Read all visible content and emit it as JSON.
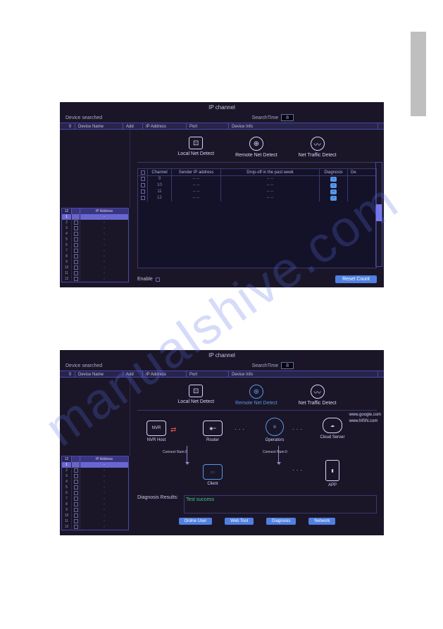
{
  "watermark": "manualshive.com",
  "screenshot1": {
    "title": "IP channel",
    "device_searched": "Device searched",
    "search_time_label": "SearchTime",
    "search_time_value": "8",
    "header": {
      "count": "0",
      "device_name": "Device Name",
      "add": "Add",
      "ip_address": "IP Address",
      "port": "Port",
      "device_info": "Device Info"
    },
    "tabs": {
      "local": "Local Net Detect",
      "remote": "Remote Net Detect",
      "traffic": "Net Traffic Detect"
    },
    "ip_list": {
      "count": "12",
      "header": "IP Address",
      "rows": [
        {
          "n": "1",
          "v": "-"
        },
        {
          "n": "2",
          "v": "-"
        },
        {
          "n": "3",
          "v": "-"
        },
        {
          "n": "4",
          "v": "-"
        },
        {
          "n": "5",
          "v": "-"
        },
        {
          "n": "6",
          "v": "-"
        },
        {
          "n": "7",
          "v": "-"
        },
        {
          "n": "8",
          "v": "-"
        },
        {
          "n": "9",
          "v": "-"
        },
        {
          "n": "10",
          "v": "-"
        },
        {
          "n": "11",
          "v": "-"
        },
        {
          "n": "12",
          "v": "-"
        }
      ]
    },
    "data_table": {
      "cols": {
        "channel": "Channel",
        "sender": "Sender IP address",
        "dropoff": "Drop-off in the past week",
        "diag": "Diagnosis",
        "de": "De"
      },
      "rows": [
        {
          "ch": "9",
          "ip": "-- --",
          "drop": "-- --",
          "diag": "--"
        },
        {
          "ch": "10",
          "ip": "-- --",
          "drop": "-- --",
          "diag": "--"
        },
        {
          "ch": "11",
          "ip": "-- --",
          "drop": "-- --",
          "diag": "--"
        },
        {
          "ch": "12",
          "ip": "-- --",
          "drop": "-- --",
          "diag": "--"
        }
      ]
    },
    "enable_label": "Enable",
    "reset_btn": "Reset Count"
  },
  "screenshot2": {
    "title": "IP channel",
    "device_searched": "Device searched",
    "search_time_label": "SearchTime",
    "search_time_value": "8",
    "header": {
      "count": "0",
      "device_name": "Device Name",
      "add": "Add",
      "ip_address": "IP Address",
      "port": "Port",
      "device_info": "Device Info"
    },
    "tabs": {
      "local": "Local Net Detect",
      "remote": "Remote Net Detect",
      "traffic": "Net Traffic Detect"
    },
    "ip_list": {
      "count": "12",
      "header": "IP Address",
      "rows": [
        {
          "n": "1",
          "v": "-"
        },
        {
          "n": "2",
          "v": "-"
        },
        {
          "n": "3",
          "v": "-"
        },
        {
          "n": "4",
          "v": "-"
        },
        {
          "n": "5",
          "v": "-"
        },
        {
          "n": "6",
          "v": "-"
        },
        {
          "n": "7",
          "v": "-"
        },
        {
          "n": "8",
          "v": "-"
        },
        {
          "n": "9",
          "v": "-"
        },
        {
          "n": "10",
          "v": "-"
        },
        {
          "n": "11",
          "v": "-"
        },
        {
          "n": "12",
          "v": "-"
        }
      ]
    },
    "diagram": {
      "nvr_label": "NVR Host",
      "nvr_tag": "NVR",
      "router": "Router",
      "operators": "Operators",
      "cloud": "Cloud Server",
      "client": "Client",
      "app": "APP",
      "connect1": "Connect Num:0",
      "connect2": "Connect Num:0",
      "urls": [
        "www.google.com",
        "www.MSN.com"
      ]
    },
    "diag_result_label": "Diagnosis Results:",
    "diag_result_value": "Test success",
    "buttons": {
      "online": "Online User",
      "web": "Web Tool",
      "diag": "Diagnosis",
      "net": "Network"
    }
  }
}
